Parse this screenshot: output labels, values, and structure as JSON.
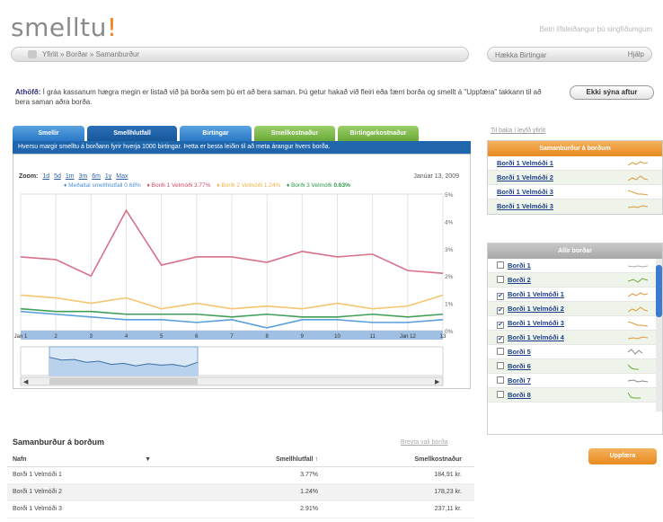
{
  "header": {
    "logo_text": "smelltu",
    "logo_accent": "!",
    "tagline": "Betri lífsleiðangur þú singfíðumgum"
  },
  "breadcrumb": {
    "text": "Yfirlit » Borðar » Samanburður"
  },
  "search": {
    "placeholder": "Hækka Birtingar",
    "button": "Hjálp"
  },
  "notice": {
    "title": "Athöfð:",
    "text": "Í gráa kassanum hægra megin er listað við þá borða sem þú ert að bera saman. Þú getur hakað við fleiri eða færri borða og smellt á \"Uppfæra\" takkann til að bera saman aðra borða.",
    "button": "Ekki sýna aftur"
  },
  "tabs": [
    "Smellir",
    "Smellhlutfall",
    "Birtingar",
    "Smellkostnaður",
    "Birtingarkostnaður"
  ],
  "info_bar": "Hversu margir smelltu á borðann fyrir hverja 1000 birtingar. Þetta er besta leiðin til að meta árangur hvers borða.",
  "chart": {
    "zoom_label": "Zoom:",
    "zoom_options": [
      "1d",
      "5d",
      "1m",
      "3m",
      "6m",
      "1y",
      "Max"
    ],
    "date_label": "Janúar 13, 2009",
    "legend": [
      {
        "name": "Meðaltal smellhlutfall",
        "value": "0.68%",
        "color": "#4a90d9"
      },
      {
        "name": "Borði 1 Velmóði",
        "value": "3.77%",
        "color": "#d04a6a"
      },
      {
        "name": "Borði 2 Velmóði",
        "value": "1.24%",
        "color": "#f0b040"
      },
      {
        "name": "Borði 3 Velmóði",
        "value": "0.63%",
        "color": "#2e9a4a"
      }
    ]
  },
  "chart_data": {
    "type": "line",
    "x": [
      "Jan 1",
      "2",
      "3",
      "4",
      "5",
      "6",
      "7",
      "8",
      "9",
      "10",
      "11",
      "Jan 12",
      "13"
    ],
    "yticks": [
      "5%",
      "4%",
      "3%",
      "2%",
      "1%",
      "0%"
    ],
    "ylim": [
      0,
      5
    ],
    "series": [
      {
        "name": "Borði 1 Velmóði",
        "color": "#d8708a",
        "values": [
          2.7,
          2.6,
          2.0,
          4.4,
          2.4,
          2.7,
          2.7,
          2.5,
          2.9,
          2.7,
          2.8,
          2.2,
          2.1
        ]
      },
      {
        "name": "Borði 2 Velmóði",
        "color": "#f3c670",
        "values": [
          1.3,
          1.2,
          1.0,
          1.2,
          0.8,
          1.0,
          0.8,
          0.9,
          0.8,
          1.0,
          0.8,
          0.9,
          1.3
        ]
      },
      {
        "name": "Borði 3 Velmóði",
        "color": "#3f9f59",
        "values": [
          0.8,
          0.7,
          0.7,
          0.6,
          0.6,
          0.6,
          0.5,
          0.6,
          0.5,
          0.5,
          0.6,
          0.5,
          0.6
        ]
      },
      {
        "name": "Meðaltal smellhlutfall",
        "color": "#5b9fdc",
        "values": [
          0.7,
          0.6,
          0.5,
          0.4,
          0.4,
          0.3,
          0.4,
          0.1,
          0.4,
          0.4,
          0.3,
          0.3,
          0.4
        ]
      }
    ],
    "navigator": [
      0.68,
      0.55,
      0.58,
      0.45,
      0.5,
      0.35,
      0.4,
      0.28,
      0.38,
      0.32,
      0.35,
      0.25,
      0.45
    ]
  },
  "summary": {
    "heading": "Samanburður á borðum",
    "link": "Breyta vali borða",
    "columns": [
      "Nafn",
      "Smellhlutfall ↑",
      "Smellkostnaður"
    ],
    "rows": [
      {
        "name": "Borði 1 Velmóði 1",
        "ctr": "3.77%",
        "cost": "184,91 kr."
      },
      {
        "name": "Borði 1 Velmóði 2",
        "ctr": "1.24%",
        "cost": "178,23 kr."
      },
      {
        "name": "Borði 1 Velmóði 3",
        "ctr": "2.91%",
        "cost": "237,11 kr."
      }
    ]
  },
  "sidebar": {
    "link": "Til baka í leyfð yfirlit",
    "compare_title": "Samanburður á borðum",
    "compare_items": [
      {
        "label": "Borði 1 Velmóði 1",
        "color": "#e09a3a"
      },
      {
        "label": "Borði 1 Velmóði 2",
        "color": "#e09a3a"
      },
      {
        "label": "Borði 1 Velmóði 3",
        "color": "#e09a3a"
      },
      {
        "label": "Borði 1 Velmóði 3",
        "color": "#e09a3a"
      }
    ],
    "all_title": "Allir borðar",
    "all_items": [
      {
        "label": "Borði 1",
        "checked": false,
        "color": "#aaaaaa"
      },
      {
        "label": "Borði 2",
        "checked": false,
        "color": "#6aa938"
      },
      {
        "label": "Borði 1 Velmóði 1",
        "checked": true,
        "color": "#e09a3a"
      },
      {
        "label": "Borði 1 Velmóði 2",
        "checked": true,
        "color": "#e09a3a"
      },
      {
        "label": "Borði 1 Velmóði 3",
        "checked": true,
        "color": "#e09a3a"
      },
      {
        "label": "Borði 1 Velmóði 4",
        "checked": true,
        "color": "#e09a3a"
      },
      {
        "label": "Borði 5",
        "checked": false,
        "color": "#888888"
      },
      {
        "label": "Borði 6",
        "checked": false,
        "color": "#6aa938"
      },
      {
        "label": "Borði 7",
        "checked": false,
        "color": "#888888"
      },
      {
        "label": "Borði 8",
        "checked": false,
        "color": "#6aa938"
      }
    ],
    "update_button": "Uppfæra"
  }
}
